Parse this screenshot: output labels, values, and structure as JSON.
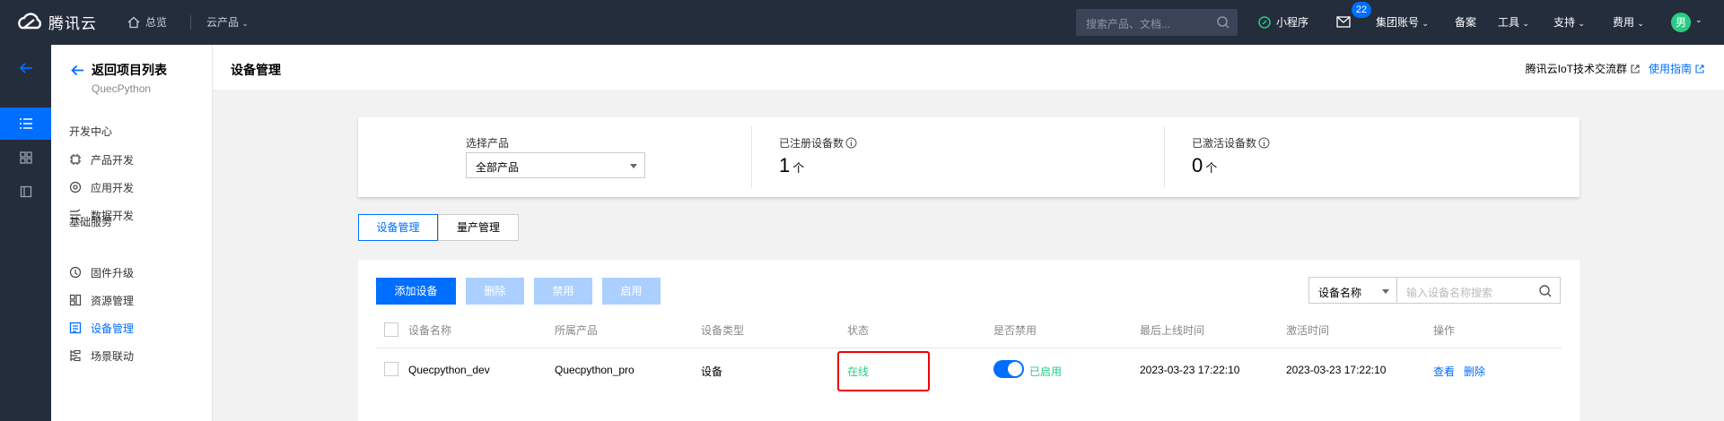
{
  "topnav": {
    "logo_text": "腾讯云",
    "home_label": "总览",
    "cloud_products": "云产品",
    "search_placeholder": "搜索产品、文档...",
    "mini_program": "小程序",
    "mail_badge": "22",
    "account": "集团账号",
    "beian": "备案",
    "tools": "工具",
    "support": "支持",
    "billing": "费用",
    "avatar_text": "男"
  },
  "sidebar": {
    "back_label": "返回项目列表",
    "project_name": "QuecPython",
    "group_dev": "开发中心",
    "dev_items": [
      "产品开发",
      "应用开发",
      "数据开发"
    ],
    "group_base": "基础服务",
    "base_items": [
      "固件升级",
      "资源管理",
      "设备管理",
      "场景联动"
    ]
  },
  "header": {
    "title": "设备管理",
    "link_group": "腾讯云IoT技术交流群",
    "link_guide": "使用指南"
  },
  "stats": {
    "product_label": "选择产品",
    "product_value": "全部产品",
    "registered_label": "已注册设备数",
    "registered_value": "1",
    "registered_unit": "个",
    "activated_label": "已激活设备数",
    "activated_value": "0",
    "activated_unit": "个"
  },
  "tabs": [
    "设备管理",
    "量产管理"
  ],
  "toolbar": {
    "add": "添加设备",
    "delete": "删除",
    "disable": "禁用",
    "enable": "启用",
    "filter_field": "设备名称",
    "filter_placeholder": "输入设备名称搜索"
  },
  "table": {
    "headers": [
      "设备名称",
      "所属产品",
      "设备类型",
      "状态",
      "是否禁用",
      "最后上线时间",
      "激活时间",
      "操作"
    ],
    "rows": [
      {
        "name": "Quecpython_dev",
        "product": "Quecpython_pro",
        "type": "设备",
        "status": "在线",
        "enabled": "已启用",
        "last_online": "2023-03-23 17:22:10",
        "activated": "2023-03-23 17:22:10",
        "action_view": "查看",
        "action_delete": "删除"
      }
    ]
  },
  "colors": {
    "accent": "#006eff",
    "online": "#29cc85",
    "nav_bg": "#242d3c",
    "highlight": "#e00000"
  }
}
